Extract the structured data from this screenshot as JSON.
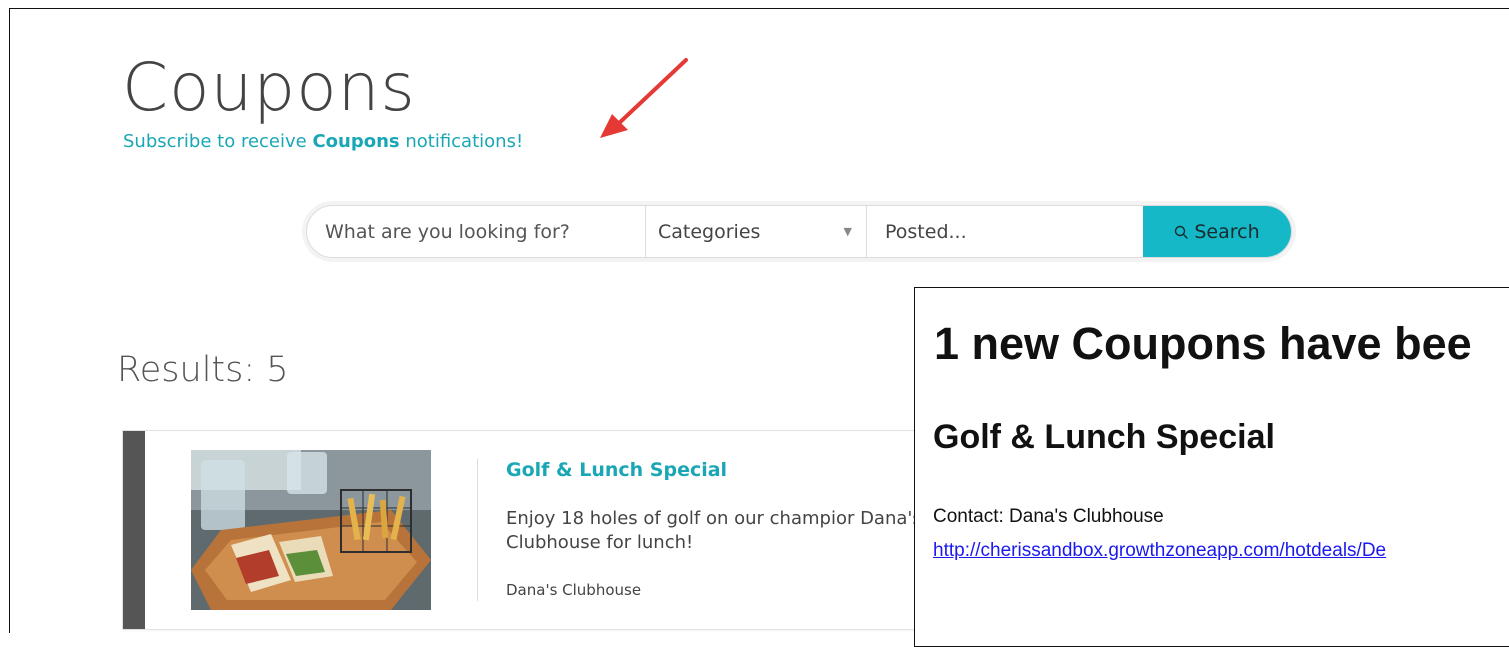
{
  "header": {
    "title": "Coupons",
    "subscribe": {
      "prefix": "Subscribe to receive ",
      "bold": "Coupons",
      "suffix": " notifications!"
    }
  },
  "search": {
    "placeholder": "What are you looking for?",
    "categories_label": "Categories",
    "posted_label": "Posted...",
    "button_label": "Search"
  },
  "results": {
    "label": "Results: 5"
  },
  "coupons": [
    {
      "title": "Golf & Lunch Special",
      "description": "Enjoy 18 holes of golf on our champior Dana's Clubhouse for lunch!",
      "contact": "Dana's Clubhouse"
    }
  ],
  "email": {
    "heading": "1 new Coupons have bee",
    "subheading": "Golf & Lunch Special",
    "contact": "Contact: Dana's Clubhouse",
    "link": "http://cherissandbox.growthzoneapp.com/hotdeals/De"
  },
  "colors": {
    "accent": "#14b8c6",
    "link": "#1aa7b5",
    "annotation_arrow": "#e53935"
  }
}
